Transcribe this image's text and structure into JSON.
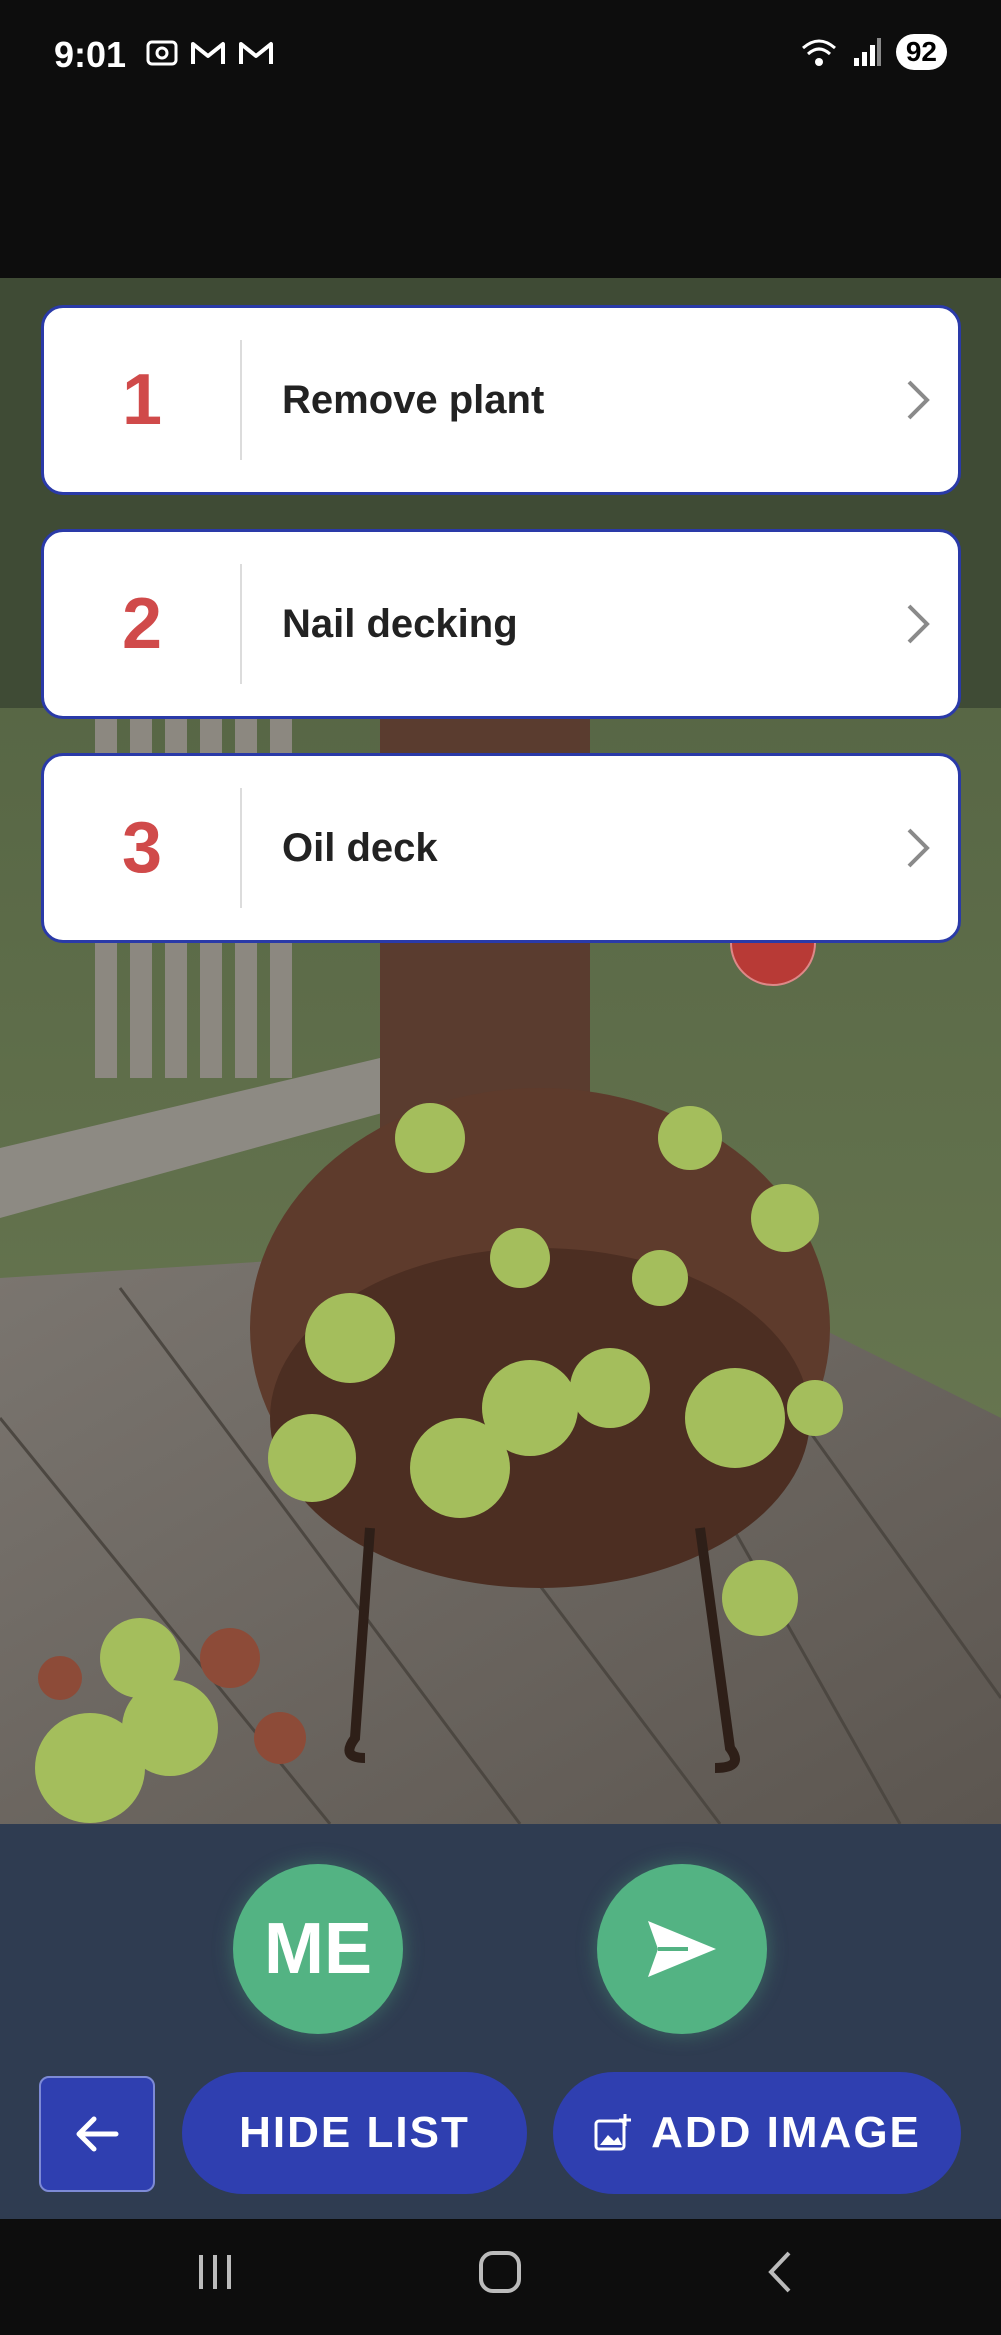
{
  "status": {
    "time": "9:01",
    "battery": "92"
  },
  "steps": [
    {
      "number": "1",
      "label": "Remove plant"
    },
    {
      "number": "2",
      "label": "Nail decking"
    },
    {
      "number": "3",
      "label": "Oil deck"
    }
  ],
  "actions": {
    "me_label": "ME",
    "hide_list_label": "HIDE LIST",
    "add_image_label": "ADD IMAGE"
  },
  "icons": {
    "send": "send-icon",
    "back": "arrow-left-icon",
    "add_image": "add-photo-icon"
  },
  "colors": {
    "accent_blue": "#2f3fb0",
    "accent_green": "#53b383",
    "step_number_red": "#d04a4a",
    "panel_bg": "#2f3c51"
  }
}
